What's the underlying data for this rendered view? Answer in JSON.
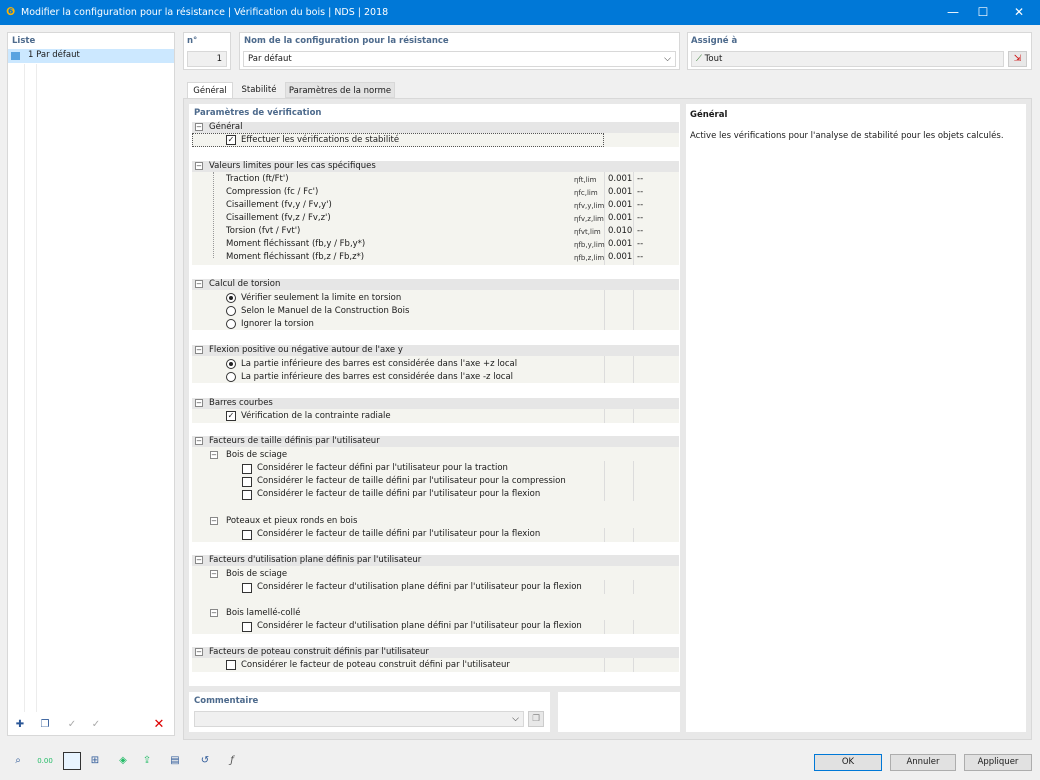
{
  "window": {
    "title": "Modifier la configuration pour la résistance | Vérification du bois | NDS | 2018",
    "minimize": "—",
    "maximize": "☐",
    "close": "✕"
  },
  "list": {
    "header": "Liste",
    "items": [
      {
        "label": "1  Par défaut"
      }
    ]
  },
  "config": {
    "no_header": "n°",
    "no_value": "1",
    "name_header": "Nom de la configuration pour la résistance",
    "name_value": "Par défaut",
    "assigned_header": "Assigné à",
    "assigned_value": "Tout"
  },
  "tabs": [
    "Général",
    "Stabilité",
    "Paramètres de la norme"
  ],
  "params": {
    "header": "Paramètres de vérification",
    "general": {
      "title": "Général",
      "stability": "Effectuer les vérifications de stabilité"
    },
    "limits": {
      "title": "Valeurs limites pour les cas spécifiques",
      "rows": [
        {
          "label": "Traction (ft/Ft')",
          "symbol": "ηft,lim",
          "value": "0.001",
          "unit": "--"
        },
        {
          "label": "Compression (fc / Fc')",
          "symbol": "ηfc,lim",
          "value": "0.001",
          "unit": "--"
        },
        {
          "label": "Cisaillement (fv,y / Fv,y')",
          "symbol": "ηfv,y,lim",
          "value": "0.001",
          "unit": "--"
        },
        {
          "label": "Cisaillement (fv,z / Fv,z')",
          "symbol": "ηfv,z,lim",
          "value": "0.001",
          "unit": "--"
        },
        {
          "label": "Torsion (fvt / Fvt')",
          "symbol": "ηfvt,lim",
          "value": "0.010",
          "unit": "--"
        },
        {
          "label": "Moment fléchissant (fb,y / Fb,y*)",
          "symbol": "ηfb,y,lim",
          "value": "0.001",
          "unit": "--"
        },
        {
          "label": "Moment fléchissant (fb,z / Fb,z*)",
          "symbol": "ηfb,z,lim",
          "value": "0.001",
          "unit": "--"
        }
      ]
    },
    "torsion": {
      "title": "Calcul de torsion",
      "opt1": "Vérifier seulement la limite en torsion",
      "opt2": "Selon le Manuel de la Construction Bois",
      "opt3": "Ignorer la torsion"
    },
    "flexion": {
      "title": "Flexion positive ou négative autour de l'axe y",
      "opt1": "La partie inférieure des barres est considérée dans l'axe +z local",
      "opt2": "La partie inférieure des barres est considérée dans l'axe -z local"
    },
    "curved": {
      "title": "Barres courbes",
      "check": "Vérification de la contrainte radiale"
    },
    "size": {
      "title": "Facteurs de taille définis par l'utilisateur",
      "sawn": "Bois de sciage",
      "c1": "Considérer le facteur défini par l'utilisateur pour la traction",
      "c2": "Considérer le facteur de taille défini par l'utilisateur pour la compression",
      "c3": "Considérer le facteur de taille défini par l'utilisateur pour la flexion",
      "poles": "Poteaux et pieux ronds en bois",
      "c4": "Considérer le facteur de taille défini par l'utilisateur pour la flexion"
    },
    "flat": {
      "title": "Facteurs d'utilisation plane définis par l'utilisateur",
      "sawn": "Bois de sciage",
      "c1": "Considérer le facteur d'utilisation plane défini par l'utilisateur pour la flexion",
      "glulam": "Bois lamellé-collé",
      "c2": "Considérer le facteur d'utilisation plane défini par l'utilisateur pour la flexion"
    },
    "column": {
      "title": "Facteurs de poteau construit définis par l'utilisateur",
      "c1": "Considérer le facteur de poteau construit défini par l'utilisateur"
    }
  },
  "info": {
    "title": "Général",
    "text": "Active les vérifications pour l'analyse de stabilité pour les objets calculés."
  },
  "comment": {
    "header": "Commentaire",
    "value": ""
  },
  "buttons": {
    "ok": "OK",
    "cancel": "Annuler",
    "apply": "Appliquer"
  }
}
